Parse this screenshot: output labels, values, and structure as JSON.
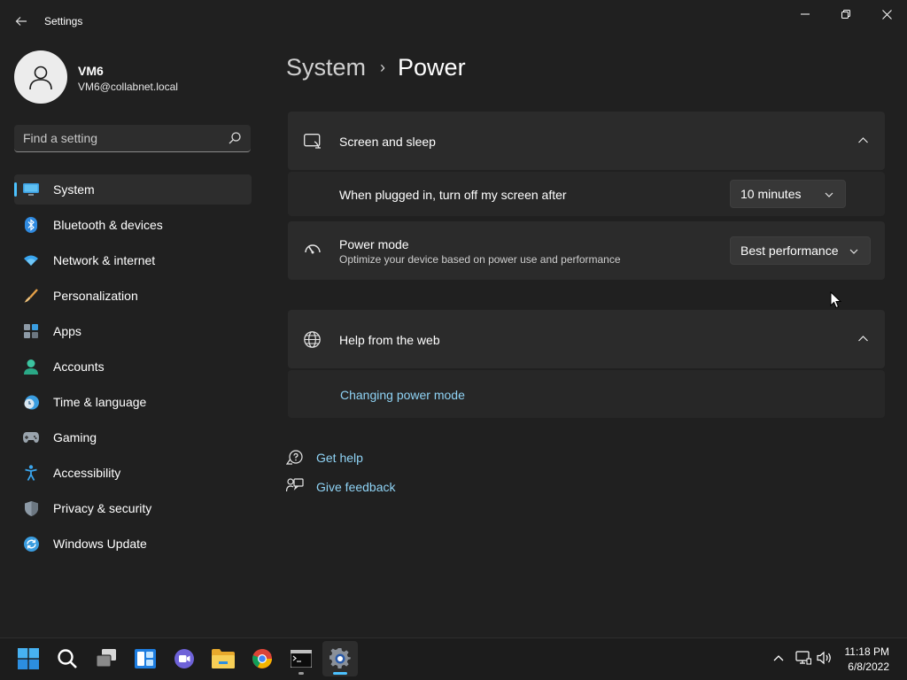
{
  "window": {
    "title": "Settings",
    "controls": [
      "minimize",
      "restore",
      "close"
    ]
  },
  "user": {
    "name": "VM6",
    "email": "VM6@collabnet.local"
  },
  "search": {
    "placeholder": "Find a setting",
    "value": ""
  },
  "sidebar": {
    "items": [
      {
        "label": "System",
        "icon": "monitor-icon",
        "active": true
      },
      {
        "label": "Bluetooth & devices",
        "icon": "bluetooth-icon"
      },
      {
        "label": "Network & internet",
        "icon": "wifi-icon"
      },
      {
        "label": "Personalization",
        "icon": "brush-icon"
      },
      {
        "label": "Apps",
        "icon": "apps-icon"
      },
      {
        "label": "Accounts",
        "icon": "person-icon"
      },
      {
        "label": "Time & language",
        "icon": "clock-globe-icon"
      },
      {
        "label": "Gaming",
        "icon": "gamepad-icon"
      },
      {
        "label": "Accessibility",
        "icon": "accessibility-icon"
      },
      {
        "label": "Privacy & security",
        "icon": "shield-icon"
      },
      {
        "label": "Windows Update",
        "icon": "update-icon"
      }
    ]
  },
  "breadcrumb": {
    "parent": "System",
    "separator": "›",
    "current": "Power"
  },
  "screen_sleep": {
    "title": "Screen and sleep",
    "expanded": true,
    "plugged_in_label": "When plugged in, turn off my screen after",
    "plugged_in_value": "10 minutes"
  },
  "power_mode": {
    "title": "Power mode",
    "description": "Optimize your device based on power use and performance",
    "value": "Best performance"
  },
  "help_web": {
    "title": "Help from the web",
    "expanded": true,
    "link": "Changing power mode"
  },
  "footer_links": {
    "get_help": "Get help",
    "give_feedback": "Give feedback"
  },
  "taskbar": {
    "apps": [
      "start-icon",
      "search-icon",
      "task-view-icon",
      "widgets-icon",
      "chat-icon",
      "file-explorer-icon",
      "chrome-icon",
      "terminal-icon",
      "settings-icon"
    ],
    "time": "11:18 PM",
    "date": "6/8/2022"
  },
  "colors": {
    "background": "#202020",
    "card": "#2b2b2b",
    "accent": "#4cc2ff",
    "link": "#8fd3f5"
  }
}
